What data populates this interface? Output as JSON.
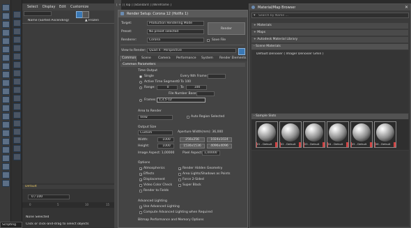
{
  "colors": {
    "accent_blue": "#3a78b4",
    "swatch_red": "#d04545",
    "status_green": "#6aa84f"
  },
  "explorer": {
    "menus": [
      "Select",
      "Display",
      "Edit",
      "Customize"
    ],
    "column_name": "Name (Sorted Ascending)",
    "column_frozen": "▲ Frozen",
    "layer": "Default"
  },
  "viewport": {
    "label": "[ + ] [Top ] [Standard ] [Wireframe ]"
  },
  "render": {
    "title": "Render Setup: Corona 12 (Hotfix 1)",
    "target_label": "Target:",
    "target_value": "Production Rendering Mode",
    "preset_label": "Preset:",
    "preset_value": "No preset selected",
    "renderer_label": "Renderer:",
    "renderer_value": "Corona",
    "save_file": "Save File",
    "view_label": "View to Render:",
    "view_value": "Quad 4 - Perspective",
    "render_button": "Render",
    "tabs": [
      "Common",
      "Scene",
      "Camera",
      "Performance",
      "System",
      "Render Elements"
    ],
    "common_header": "Common Parameters",
    "time_output": "Time Output",
    "single": "Single",
    "every_nth": "Every Nth Frame:",
    "active_segment": "Active Time Segment:",
    "active_range": "0 To 100",
    "range": "Range:",
    "range_from": "0",
    "range_to": "To",
    "range_end": "100",
    "file_base": "File Number Base:",
    "frames": "Frames",
    "frames_value": "1,3,5-12",
    "area_header": "Area to Render",
    "area_value": "View",
    "auto_region": "Auto Region Selected",
    "output_size": "Output Size",
    "size_preset": "Custom",
    "aperture": "Aperture Width(mm): 36,000",
    "width_label": "Width:",
    "width_value": "1000",
    "height_label": "Height:",
    "height_value": "1000",
    "presets": [
      "256x256",
      "1024x1024",
      "1536x1536",
      "4096x4096"
    ],
    "image_aspect": "Image Aspect: 1,00000",
    "pixel_aspect": "Pixel Aspect:",
    "pixel_aspect_value": "1,00000",
    "options_header": "Options",
    "options": [
      "Atmospherics",
      "Render Hidden Geometry",
      "Effects",
      "Area Lights/Shadows as Points",
      "Displacement",
      "Force 2-Sided",
      "Video Color Check",
      "Super Black",
      "Render to Fields"
    ],
    "adv_lighting": "Advanced Lighting",
    "use_adv": "Use Advanced Lighting",
    "compute_adv": "Compute Advanced Lighting when Required",
    "bitmap_perf": "Bitmap Performance and Memory Options"
  },
  "matbrowser": {
    "title": "Material/Map Browser",
    "search_placeholder": "Search by Name ...",
    "groups": [
      "+ Materials",
      "+ Maps",
      "+ Autodesk Material Library",
      "- Scene Materials"
    ],
    "scene_item": "Default Denoiser ( Imager Denoiser Gmin )",
    "sample_slots": "- Sample Slots",
    "slots": [
      "01 - Default",
      "02 - Default",
      "03 - Default",
      "04 - Default",
      "05 - Default",
      "06 - Default"
    ]
  },
  "timeline": {
    "frame": "0 / 100",
    "ticks": [
      "0",
      "5",
      "10",
      "15"
    ],
    "status1": "None Selected",
    "status2": "Click or click-and-drag to select objects",
    "script": "Scripting"
  }
}
